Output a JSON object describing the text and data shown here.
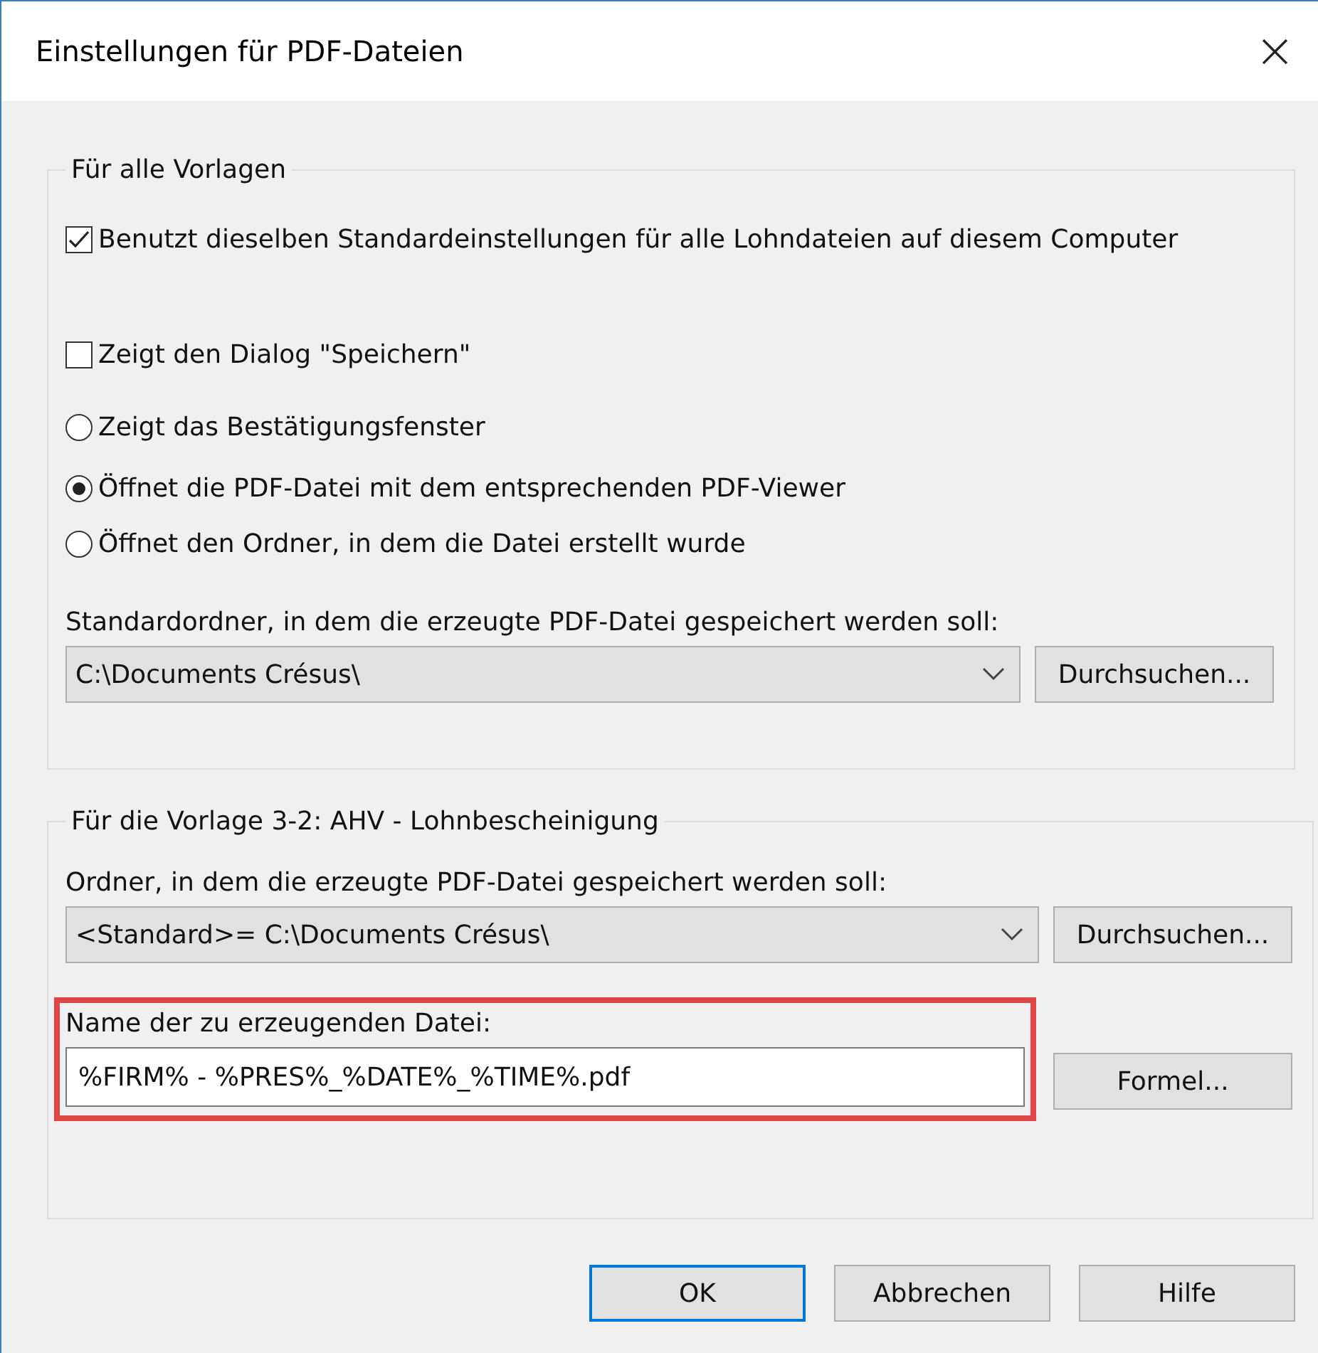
{
  "window": {
    "title": "Einstellungen für PDF-Dateien",
    "close": "×"
  },
  "group_all": {
    "title": "Für alle Vorlagen",
    "options": [
      {
        "kind": "checkbox",
        "label": "Benutzt dieselben Standardeinstellungen für alle Lohndateien auf diesem Computer",
        "checked": true
      },
      {
        "kind": "checkbox",
        "label": "Zeigt den Dialog \"Speichern\"",
        "checked": false
      },
      {
        "kind": "radio",
        "label": "Zeigt das Bestätigungsfenster",
        "selected": false
      },
      {
        "kind": "radio",
        "label": "Öffnet die PDF-Datei mit dem entsprechenden PDF-Viewer",
        "selected": true
      },
      {
        "kind": "radio",
        "label": "Öffnet den Ordner, in dem die Datei erstellt wurde",
        "selected": false
      }
    ],
    "folder_label": "Standardordner, in dem die erzeugte PDF-Datei gespeichert werden soll:",
    "folder_value": "C:\\Documents Crésus\\",
    "browse": "Durchsuchen..."
  },
  "group_template": {
    "title": "Für die Vorlage 3-2: AHV - Lohnbescheinigung",
    "folder_label": "Ordner, in dem die erzeugte PDF-Datei gespeichert werden soll:",
    "folder_value": "<Standard>= C:\\Documents Crésus\\",
    "browse": "Durchsuchen...",
    "file_label": "Name der zu erzeugenden Datei:",
    "file_value": "%FIRM% - %PRES%_%DATE%_%TIME%.pdf",
    "highlighted": true,
    "formula": "Formel..."
  },
  "buttons": [
    {
      "label": "OK",
      "default": true
    },
    {
      "label": "Abbrechen",
      "default": false
    },
    {
      "label": "Hilfe",
      "default": false
    }
  ]
}
